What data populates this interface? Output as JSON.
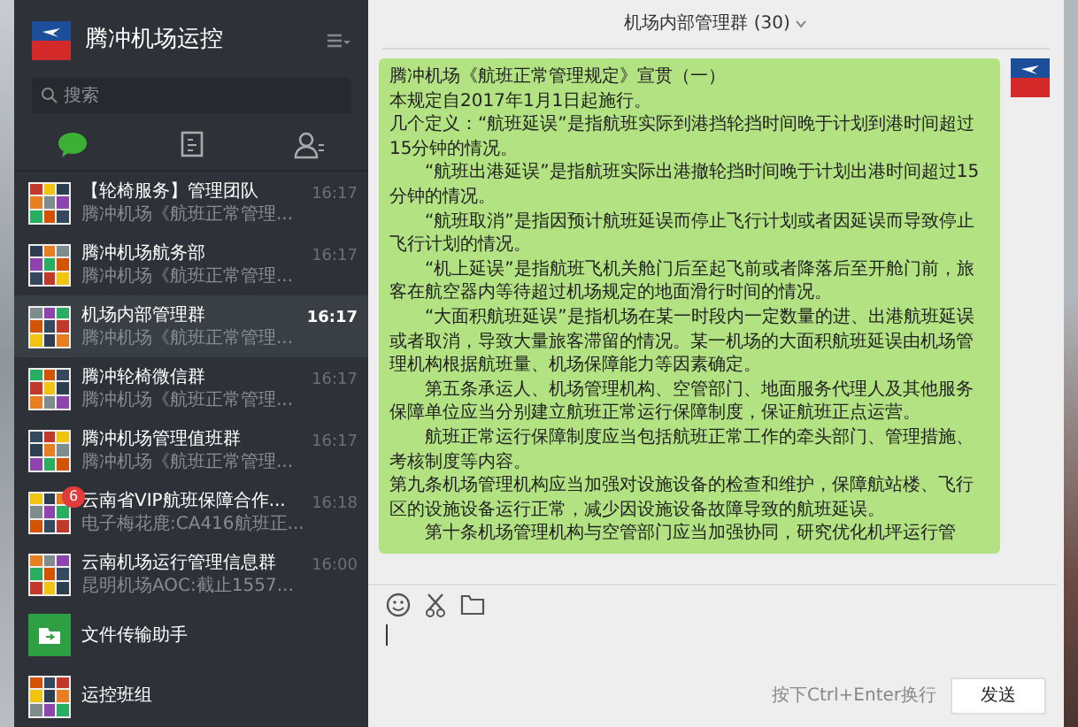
{
  "app": {
    "title": "腾冲机场运控",
    "search": {
      "placeholder": "搜索"
    },
    "tabs": [
      {
        "kind": "chat",
        "selected": true
      },
      {
        "kind": "contacts-book",
        "selected": false
      },
      {
        "kind": "people",
        "selected": false
      }
    ]
  },
  "conversations": [
    {
      "kind": "group",
      "name": "【轮椅服务】管理团队",
      "preview": "腾冲机场《航班正常管理...",
      "time": "16:17",
      "selected": false
    },
    {
      "kind": "group",
      "name": "腾冲机场航务部",
      "preview": "腾冲机场《航班正常管理...",
      "time": "16:17",
      "selected": false
    },
    {
      "kind": "group",
      "name": "机场内部管理群",
      "preview": "腾冲机场《航班正常管理...",
      "time": "16:17",
      "selected": true
    },
    {
      "kind": "group",
      "name": "腾冲轮椅微信群",
      "preview": "腾冲机场《航班正常管理...",
      "time": "16:17",
      "selected": false
    },
    {
      "kind": "group",
      "name": "腾冲机场管理值班群",
      "preview": "腾冲机场《航班正常管理...",
      "time": "16:17",
      "selected": false
    },
    {
      "kind": "group",
      "name": "云南省VIP航班保障合作...",
      "preview": "电子梅花鹿:CA416航班正...",
      "time": "16:18",
      "badge": "6",
      "selected": false
    },
    {
      "kind": "group",
      "name": "云南机场运行管理信息群",
      "preview": "昆明机场AOC:截止1557...",
      "time": "16:00",
      "selected": false
    },
    {
      "kind": "file-transfer",
      "name": "文件传输助手",
      "selected": false
    },
    {
      "kind": "group",
      "name": "运控班组",
      "selected": false
    }
  ],
  "chat": {
    "title": "机场内部管理群 (30)",
    "message": [
      {
        "text": "腾冲机场《航班正常管理规定》宣贯（一）",
        "indent": false
      },
      {
        "text": "本规定自2017年1月1日起施行。",
        "indent": false
      },
      {
        "text": "几个定义：“航班延误”是指航班实际到港挡轮挡时间晚于计划到港时间超过15分钟的情况。",
        "indent": false
      },
      {
        "text": "“航班出港延误”是指航班实际出港撤轮挡时间晚于计划出港时间超过15分钟的情况。",
        "indent": true
      },
      {
        "text": "“航班取消”是指因预计航班延误而停止飞行计划或者因延误而导致停止飞行计划的情况。",
        "indent": true
      },
      {
        "text": "“机上延误”是指航班飞机关舱门后至起飞前或者降落后至开舱门前，旅客在航空器内等待超过机场规定的地面滑行时间的情况。",
        "indent": true
      },
      {
        "text": "“大面积航班延误”是指机场在某一时段内一定数量的进、出港航班延误或者取消，导致大量旅客滞留的情况。某一机场的大面积航班延误由机场管理机构根据航班量、机场保障能力等因素确定。",
        "indent": true
      },
      {
        "text": "第五条承运人、机场管理机构、空管部门、地面服务代理人及其他服务保障单位应当分别建立航班正常运行保障制度，保证航班正点运营。",
        "indent": true
      },
      {
        "text": "航班正常运行保障制度应当包括航班正常工作的牵头部门、管理措施、考核制度等内容。",
        "indent": true
      },
      {
        "text": "第九条机场管理机构应当加强对设施设备的检查和维护，保障航站楼、飞行区的设施设备运行正常，减少因设施设备故障导致的航班延误。",
        "indent": false
      },
      {
        "text": "第十条机场管理机构与空管部门应当加强协同，研究优化机坪运行管",
        "indent": true
      }
    ],
    "hint": "按下Ctrl+Enter换行",
    "send": "发送"
  }
}
